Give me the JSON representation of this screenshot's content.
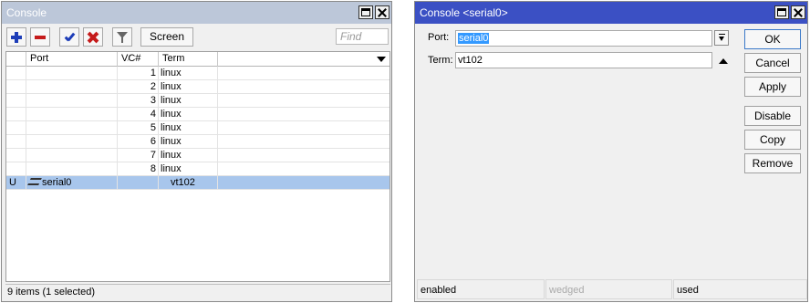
{
  "left_window": {
    "title": "Console",
    "toolbar": {
      "add_icon": "plus-icon",
      "remove_icon": "minus-icon",
      "enable_icon": "check-icon",
      "disable_icon": "x-icon",
      "filter_icon": "funnel-icon",
      "screen_label": "Screen",
      "find_placeholder": "Find"
    },
    "columns": {
      "flag": "",
      "port": "Port",
      "vc": "VC#",
      "term": "Term"
    },
    "rows": [
      {
        "flag": "",
        "port": "",
        "vc": "1",
        "term": "linux"
      },
      {
        "flag": "",
        "port": "",
        "vc": "2",
        "term": "linux"
      },
      {
        "flag": "",
        "port": "",
        "vc": "3",
        "term": "linux"
      },
      {
        "flag": "",
        "port": "",
        "vc": "4",
        "term": "linux"
      },
      {
        "flag": "",
        "port": "",
        "vc": "5",
        "term": "linux"
      },
      {
        "flag": "",
        "port": "",
        "vc": "6",
        "term": "linux"
      },
      {
        "flag": "",
        "port": "",
        "vc": "7",
        "term": "linux"
      },
      {
        "flag": "",
        "port": "",
        "vc": "8",
        "term": "linux"
      },
      {
        "flag": "U",
        "port": "serial0",
        "vc": "",
        "term": "vt102"
      }
    ],
    "status": "9 items (1 selected)"
  },
  "right_window": {
    "title": "Console <serial0>",
    "port_label": "Port:",
    "port_value": "serial0",
    "term_label": "Term:",
    "term_value": "vt102",
    "buttons": {
      "ok": "OK",
      "cancel": "Cancel",
      "apply": "Apply",
      "disable": "Disable",
      "copy": "Copy",
      "remove": "Remove"
    },
    "status": {
      "enabled": "enabled",
      "wedged": "wedged",
      "used": "used"
    }
  },
  "colors": {
    "inactive_title": "#bcc7d9",
    "active_title": "#3b50c4",
    "selection": "#a8c6ec"
  }
}
